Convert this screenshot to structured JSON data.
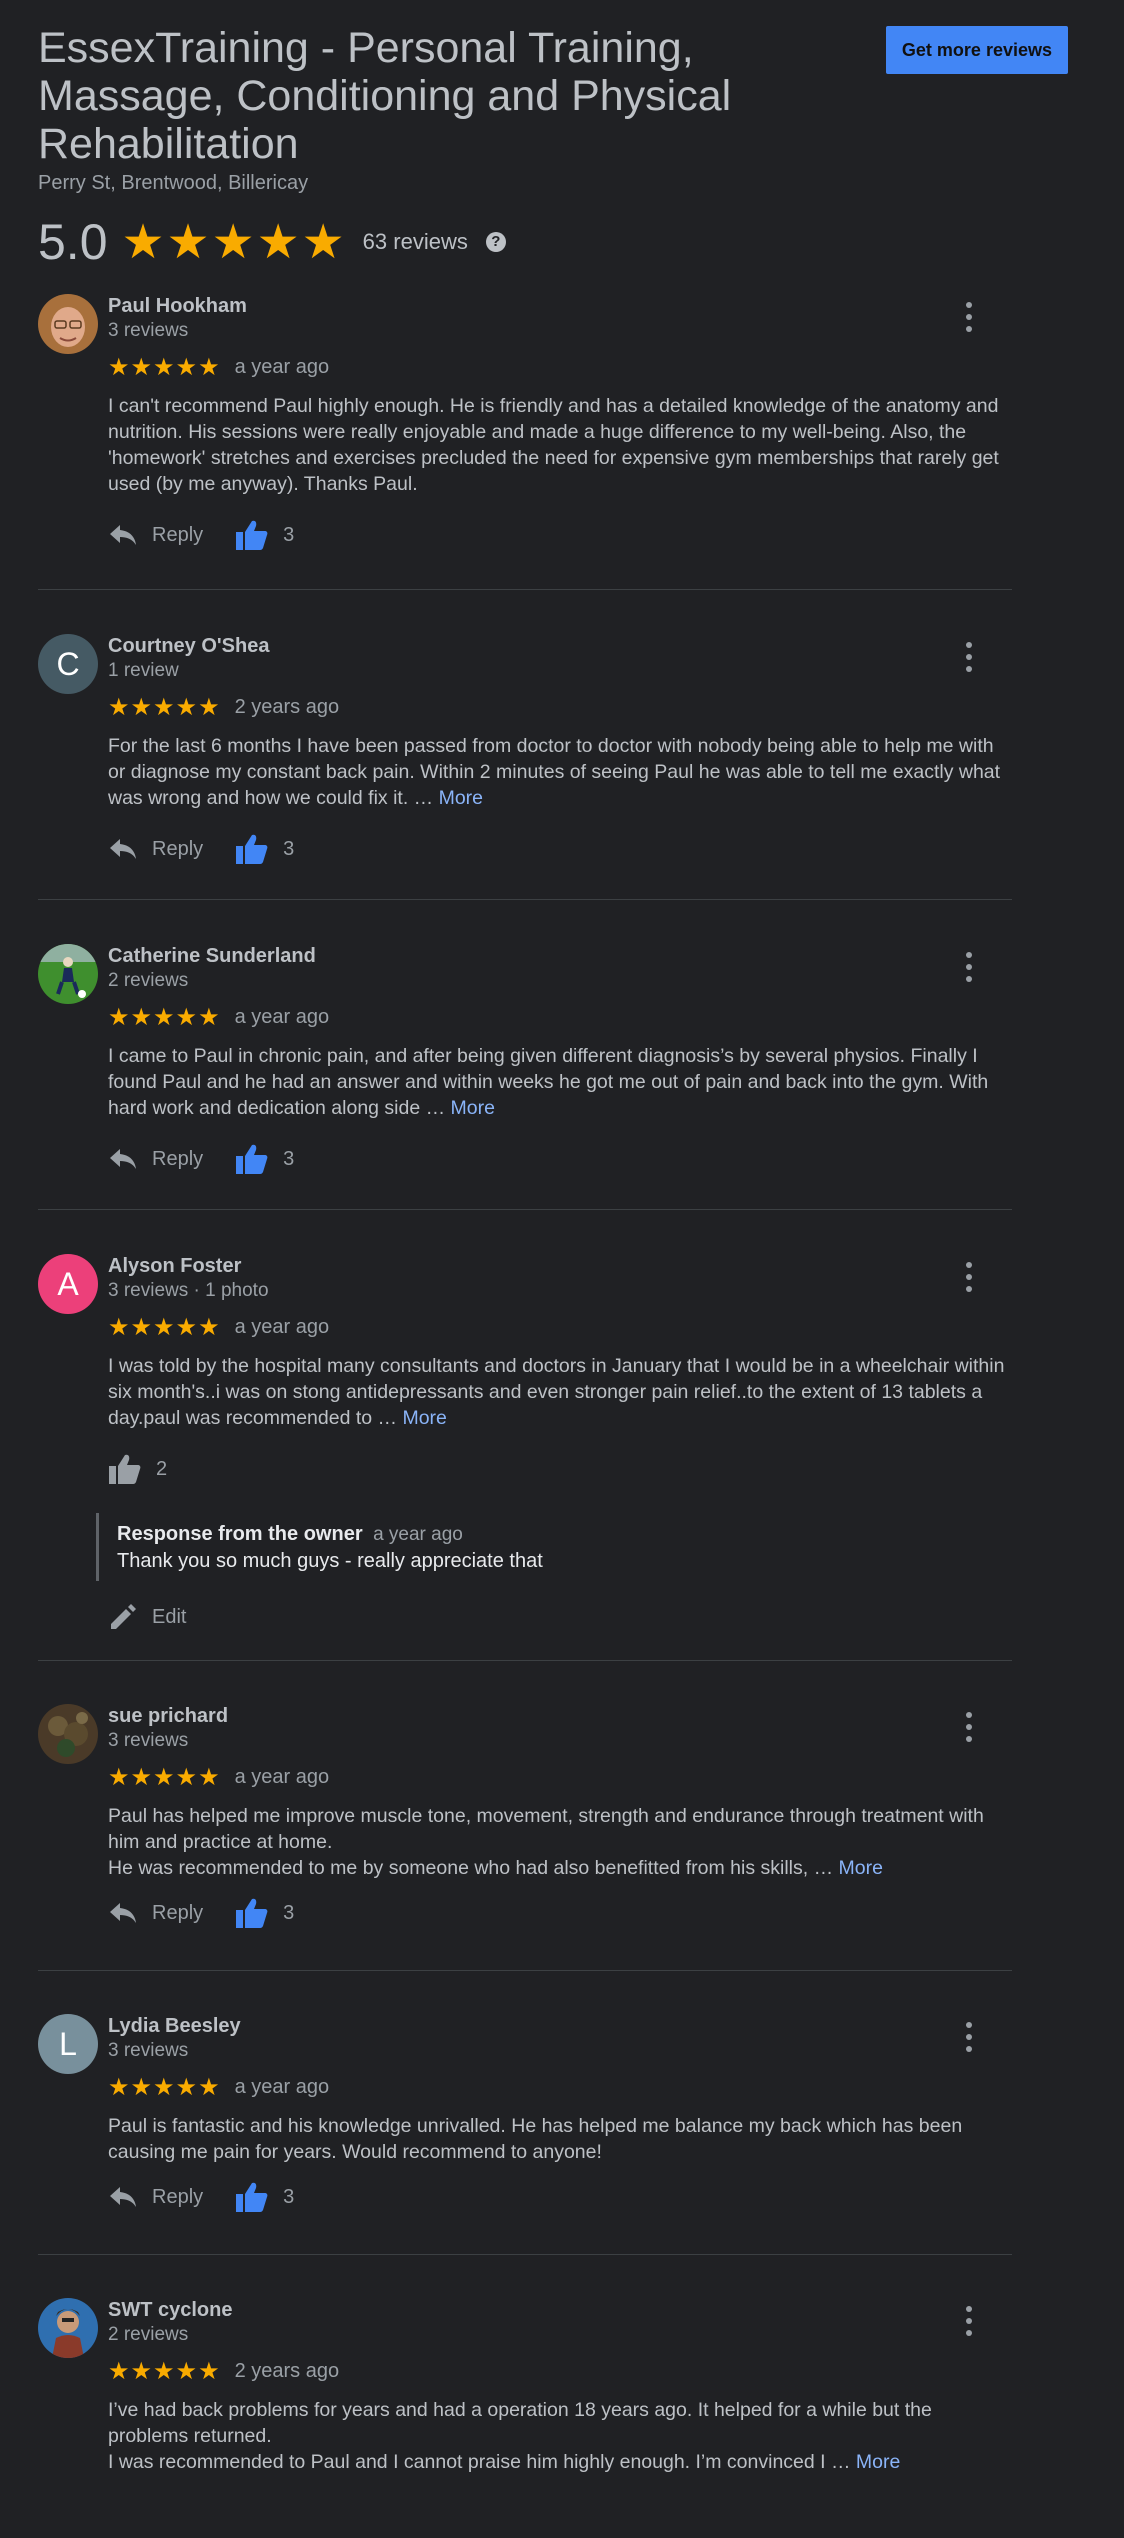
{
  "business": {
    "name": "EssexTraining - Personal Training, Massage, Conditioning and Physical Rehabilitation",
    "address": "Perry St, Brentwood, Billericay",
    "get_more_reviews": "Get more reviews",
    "rating": "5.0",
    "stars": "★★★★★",
    "review_count": "63 reviews",
    "help": "?"
  },
  "colors": {
    "background": "#202124",
    "star": "#f9ab00",
    "link": "#8ab4f8",
    "like_active": "#4286f5",
    "button": "#4286f5"
  },
  "labels": {
    "reply": "Reply",
    "edit": "Edit",
    "more": "More",
    "owner_response": "Response from the owner"
  },
  "reviews": [
    {
      "name": "Paul Hookham",
      "meta": "3 reviews",
      "stars": "★★★★★",
      "time": "a year ago",
      "text": "I can't recommend Paul highly enough. He is friendly and has a detailed knowledge of the anatomy and nutrition. His sessions were really enjoyable and made a huge difference to my well-being. Also, the 'homework' stretches and exercises precluded the need for expensive gym memberships that rarely get used (by me anyway). Thanks Paul.",
      "likes": "3",
      "avatar_icon": "photo-avatar-face"
    },
    {
      "name": "Courtney O'Shea",
      "meta": "1 review",
      "stars": "★★★★★",
      "time": "2 years ago",
      "text": "For the last 6 months I have been passed from doctor to doctor with nobody being able to help me with or diagnose my constant back pain. Within 2 minutes of seeing Paul he was able to tell me exactly what was wrong and how we could fix it. … ",
      "likes": "3",
      "avatar_letter": "C",
      "avatar_color": "#455a64"
    },
    {
      "name": "Catherine Sunderland",
      "meta": "2 reviews",
      "stars": "★★★★★",
      "time": "a year ago",
      "text": "I came to Paul in chronic pain, and after being given different diagnosis’s by several physios. Finally I found Paul and he had an answer and within weeks he got me out of pain and back into the gym. With hard work and dedication along side … ",
      "likes": "3",
      "avatar_icon": "photo-avatar-football"
    },
    {
      "name": "Alyson Foster",
      "meta": "3 reviews · 1 photo",
      "stars": "★★★★★",
      "time": "a year ago",
      "text": "I was told by the hospital many consultants and doctors in January that I would be in a wheelchair within six month's..i was on stong antidepressants and even stronger pain relief..to the extent of 13 tablets a day.paul was recommended to … ",
      "likes": "2",
      "avatar_letter": "A",
      "avatar_color": "#ec407a",
      "owner_time": "a year ago",
      "owner_text": "Thank you so much guys - really appreciate that"
    },
    {
      "name": "sue prichard",
      "meta": "3 reviews",
      "stars": "★★★★★",
      "time": "a year ago",
      "text": "Paul has helped me improve muscle tone, movement, strength and endurance through treatment with him and practice at home.\nHe was recommended to me by someone who had also benefitted from his skills, … ",
      "likes": "3",
      "avatar_icon": "photo-avatar-plant"
    },
    {
      "name": "Lydia Beesley",
      "meta": "3 reviews",
      "stars": "★★★★★",
      "time": "a year ago",
      "text": "Paul is fantastic and his knowledge unrivalled. He has helped me balance my back which has been causing me pain for years. Would recommend to anyone!",
      "likes": "3",
      "avatar_letter": "L",
      "avatar_color": "#78909c"
    },
    {
      "name": "SWT cyclone",
      "meta": "2 reviews",
      "stars": "★★★★★",
      "time": "2 years ago",
      "text": "I’ve had back problems for years and had a operation 18 years ago. It helped for a while but the problems returned.\nI was recommended to Paul and I cannot praise him highly enough. I’m convinced I … ",
      "avatar_icon": "photo-avatar-character"
    }
  ]
}
